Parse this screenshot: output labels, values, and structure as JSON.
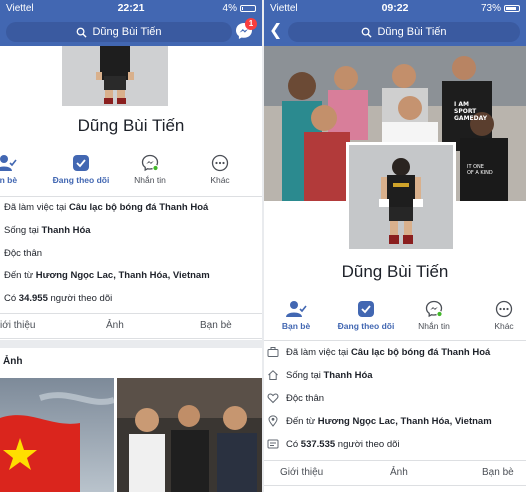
{
  "left": {
    "status": {
      "carrier": "Viettel",
      "time": "22:21",
      "battery": "4%"
    },
    "search_text": "Dũng Bùi Tiến",
    "messenger_badge": "1",
    "profile_name": "Dũng Bùi Tiến",
    "actions": [
      {
        "label": "ạn bè",
        "icon": "friends-icon"
      },
      {
        "label": "Đang theo dõi",
        "icon": "following-icon"
      },
      {
        "label": "Nhắn tin",
        "icon": "messenger-icon"
      },
      {
        "label": "Khác",
        "icon": "more-icon"
      }
    ],
    "info": {
      "work_prefix": "Đã làm việc tại ",
      "work_value": "Câu lạc bộ bóng đá Thanh Hoá",
      "lives_prefix": "Sống tại ",
      "lives_value": "Thanh Hóa",
      "relationship": "Độc thân",
      "from_prefix": "Đến từ ",
      "from_value": "Hương Ngọc Lac, Thanh Hóa, Vietnam",
      "followers_prefix": "Có ",
      "followers_value": "34.955",
      "followers_suffix": " người theo dõi"
    },
    "tabs": [
      "iới thiệu",
      "Ảnh",
      "Bạn bè"
    ],
    "photos_heading": "Ảnh"
  },
  "right": {
    "status": {
      "carrier": "Viettel",
      "time": "09:22",
      "battery": "73%"
    },
    "search_text": "Dũng Bùi Tiến",
    "cover_texts": [
      "I AM",
      "SPORT",
      "GAMEDAY",
      "IT ONE",
      "OF A KIND"
    ],
    "profile_name": "Dũng Bùi Tiến",
    "actions": [
      {
        "label": "Bạn bè",
        "icon": "friends-icon"
      },
      {
        "label": "Đang theo dõi",
        "icon": "following-icon"
      },
      {
        "label": "Nhắn tin",
        "icon": "messenger-icon"
      },
      {
        "label": "Khác",
        "icon": "more-icon"
      }
    ],
    "info": {
      "work_prefix": "Đã làm việc tại ",
      "work_value": "Câu lạc bộ bóng đá Thanh Hoá",
      "lives_prefix": "Sống tại ",
      "lives_value": "Thanh Hóa",
      "relationship": "Độc thân",
      "from_prefix": "Đến từ ",
      "from_value": "Hương Ngọc Lac, Thanh Hóa, Vietnam",
      "followers_prefix": "Có ",
      "followers_value": "537.535",
      "followers_suffix": " người theo dõi"
    },
    "tabs": [
      "Giới thiệu",
      "Ảnh",
      "Bạn bè"
    ]
  },
  "colors": {
    "facebook_blue": "#4267b2",
    "search_blue": "#3a5aa0",
    "badge_red": "#fa3e3e",
    "online_green": "#42b72a",
    "flag_red": "#da251d",
    "flag_star": "#ffde00"
  }
}
